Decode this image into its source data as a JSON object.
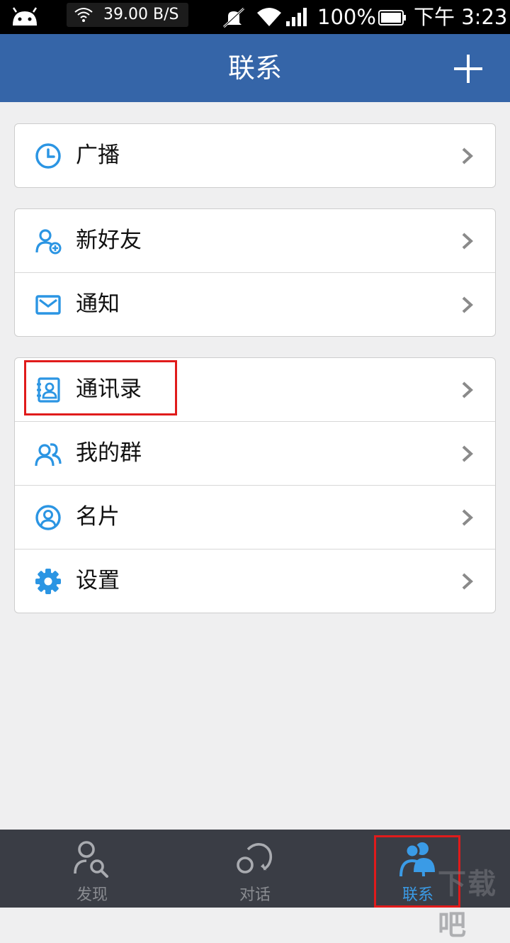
{
  "status_bar": {
    "net_speed": "39.00 B/S",
    "battery": "100%",
    "time": "下午 3:23"
  },
  "header": {
    "title": "联系",
    "add_icon": "plus-icon"
  },
  "groups": [
    {
      "items": [
        {
          "label": "广播",
          "icon": "clock-icon"
        }
      ]
    },
    {
      "items": [
        {
          "label": "新好友",
          "icon": "add-friend-icon"
        },
        {
          "label": "通知",
          "icon": "envelope-icon"
        }
      ]
    },
    {
      "items": [
        {
          "label": "通讯录",
          "icon": "contacts-book-icon"
        },
        {
          "label": "我的群",
          "icon": "group-icon"
        },
        {
          "label": "名片",
          "icon": "profile-card-icon"
        },
        {
          "label": "设置",
          "icon": "gear-icon"
        }
      ]
    }
  ],
  "bottom_nav": {
    "tabs": [
      {
        "label": "发现",
        "icon": "discover-icon",
        "active": false
      },
      {
        "label": "对话",
        "icon": "chat-icon",
        "active": false
      },
      {
        "label": "联系",
        "icon": "contacts-icon",
        "active": true
      }
    ]
  },
  "colors": {
    "appbar": "#3565a8",
    "accent": "#3a9be6",
    "nav_bg": "#3a3d45",
    "highlight": "#e01b1b"
  },
  "watermark": "下载吧"
}
